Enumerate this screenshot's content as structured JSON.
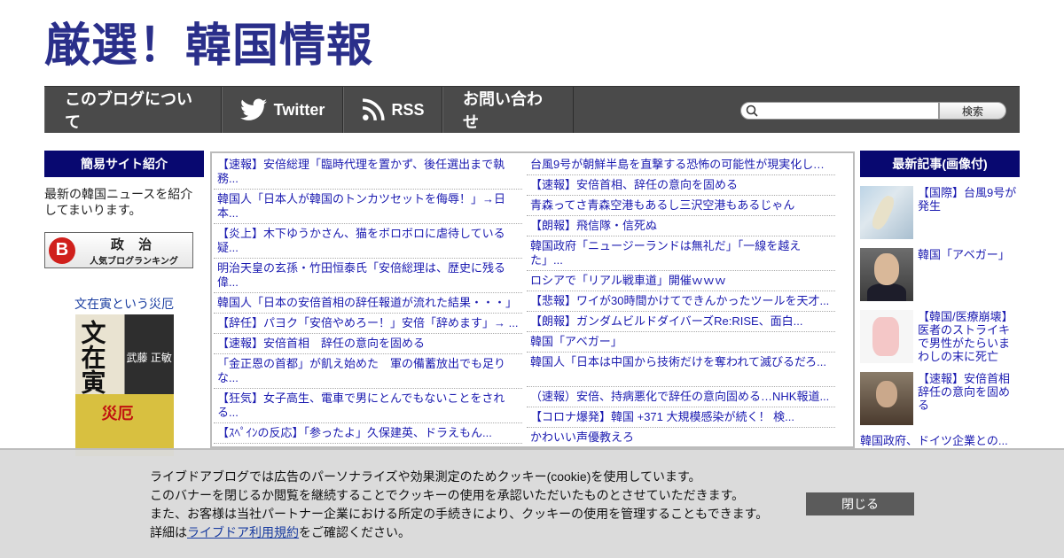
{
  "site": {
    "title": "厳選！韓国情報"
  },
  "nav": {
    "about": "このブログについて",
    "twitter": "Twitter",
    "rss": "RSS",
    "contact": "お問い合わせ",
    "search_button": "検索",
    "search_placeholder": ""
  },
  "left": {
    "heading": "簡易サイト紹介",
    "intro": "最新の韓国ニュースを紹介してまいります。",
    "ranking_title": "政 治",
    "ranking_sub": "人気ブログランキング",
    "ranking_logo": "B",
    "book_title": "文在寅という災厄",
    "book_cover_title": "文在寅",
    "book_author": "武藤 正敏",
    "book_band": "災厄"
  },
  "center": {
    "col_a": [
      {
        "text": "【速報】安倍総理「臨時代理を置かず、後任選出まで執務...",
        "lines": 2
      },
      {
        "text": "韓国人「日本人が韓国のトンカツセットを侮辱！」→日本...",
        "lines": 2
      },
      {
        "text": "【炎上】木下ゆうかさん、猫をボロボロに虐待している疑...",
        "lines": 2
      },
      {
        "text": "明治天皇の玄孫・竹田恒泰氏「安倍総理は、歴史に残る偉...",
        "lines": 2
      },
      {
        "text": "韓国人「日本の安倍首相の辞任報道が流れた結果・・・」",
        "lines": 1
      },
      {
        "text": "【辞任】パヨク「安倍やめろー！」安倍「辞めます」→ ...",
        "lines": 1
      },
      {
        "text": "【速報】安倍首相　辞任の意向を固める",
        "lines": 1
      },
      {
        "text": "「金正恩の首都」が飢え始めた　軍の備蓄放出でも足りな...",
        "lines": 2
      },
      {
        "text": "【狂気】女子高生、電車で男にとんでもないことをされる...",
        "lines": 2
      },
      {
        "text": "【ｽﾍﾟｲﾝの反応】「参ったよ」久保建英、ドラえもん...",
        "lines": 1
      }
    ],
    "col_b": [
      {
        "text": "台風9号が朝鮮半島を直撃する恐怖の可能性が現実化して...",
        "lines": 1
      },
      {
        "text": "【速報】安倍首相、辞任の意向を固める",
        "lines": 1
      },
      {
        "text": "青森ってさ青森空港もあるし三沢空港もあるじゃん",
        "lines": 1
      },
      {
        "text": "【朗報】飛信隊・信死ぬ",
        "lines": 1
      },
      {
        "text": "韓国政府「ニュージーランドは無礼だ」「一線を越えた」...",
        "lines": 2
      },
      {
        "text": "ロシアで「リアル戦車道」開催ｗｗｗ",
        "lines": 1
      },
      {
        "text": "【悲報】ワイが30時間かけてできんかったツールを天才...",
        "lines": 1
      },
      {
        "text": "【朗報】ガンダムビルドダイバーズRe:RISE、面白...",
        "lines": 1
      },
      {
        "text": "韓国「アベガー」",
        "lines": 1
      },
      {
        "text": "韓国人「日本は中国から技術だけを奪われて滅びるだろ...",
        "lines": 2
      },
      {
        "text": "（速報）安倍、持病悪化で辞任の意向固める…NHK報道...",
        "lines": 1
      },
      {
        "text": "【コロナ爆発】韓国 +371 大規模感染が続く！ 検...",
        "lines": 1
      },
      {
        "text": "かわいい声優教えろ",
        "lines": 1
      }
    ]
  },
  "right": {
    "heading": "最新記事(画像付)",
    "news": [
      {
        "title": "【国際】台風9号が発生",
        "thumb": "t-map"
      },
      {
        "title": "韓国「アベガー」",
        "thumb": "t-abe"
      },
      {
        "title": "【韓国/医療崩壊】医者のストライキで男性がたらいまわしの末に死亡",
        "thumb": "t-med"
      },
      {
        "title": "【速報】安倍首相　辞任の意向を固める",
        "thumb": "t-news"
      }
    ],
    "cut_text": "韓国政府、ドイツ企業との..."
  },
  "cookie": {
    "line1": "ライブドアブログでは広告のパーソナライズや効果測定のためクッキー(cookie)を使用しています。",
    "line2": "このバナーを閉じるか閲覧を継続することでクッキーの使用を承認いただいたものとさせていただきます。",
    "line3": "また、お客様は当社パートナー企業における所定の手続きにより、クッキーの使用を管理することもできます。",
    "line4_pre": "詳細は",
    "line4_link": "ライブドア利用規約",
    "line4_post": "をご確認ください。",
    "close": "閉じる"
  }
}
